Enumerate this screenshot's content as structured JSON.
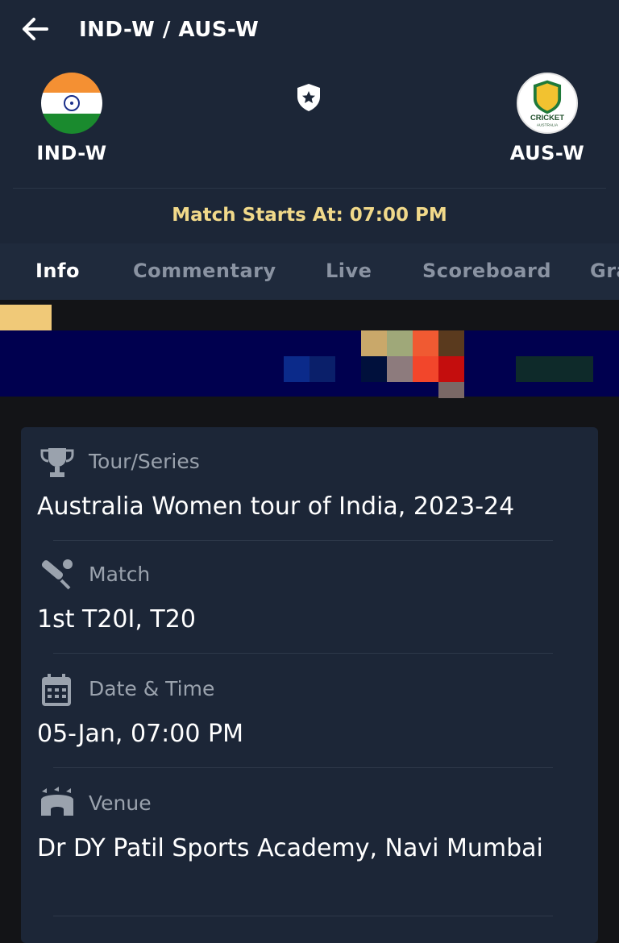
{
  "header": {
    "title": "IND-W / AUS-W",
    "back_icon": "arrow-left-icon",
    "fav_icon": "star-shield-icon"
  },
  "teams": {
    "home": {
      "name": "IND-W",
      "logo": "india-flag"
    },
    "away": {
      "name": "AUS-W",
      "logo": "cricket-australia-logo",
      "logo_text_1": "CRICKET",
      "logo_text_2": "AUSTRALIA"
    }
  },
  "match_start": "Match Starts At: 07:00 PM",
  "tabs": [
    {
      "label": "Info",
      "active": true
    },
    {
      "label": "Commentary",
      "active": false
    },
    {
      "label": "Live",
      "active": false
    },
    {
      "label": "Scoreboard",
      "active": false
    },
    {
      "label": "Gra",
      "active": false
    }
  ],
  "info": {
    "tour": {
      "label": "Tour/Series",
      "value": "Australia Women tour of India, 2023-24",
      "icon": "trophy-icon"
    },
    "match": {
      "label": "Match",
      "value": "1st T20I, T20",
      "icon": "cricket-bat-icon"
    },
    "datetime": {
      "label": "Date & Time",
      "value": "05-Jan, 07:00 PM",
      "icon": "calendar-icon"
    },
    "venue": {
      "label": "Venue",
      "value": "Dr DY Patil Sports Academy, Navi Mumbai",
      "icon": "stadium-icon"
    }
  },
  "colors": {
    "header_bg": "#1c2637",
    "accent_yellow": "#f1d98a",
    "tab_active": "#ffffff",
    "tab_inactive": "#8a93a2",
    "card_bg": "#1c2637",
    "label_gray": "#9aa2ad"
  }
}
